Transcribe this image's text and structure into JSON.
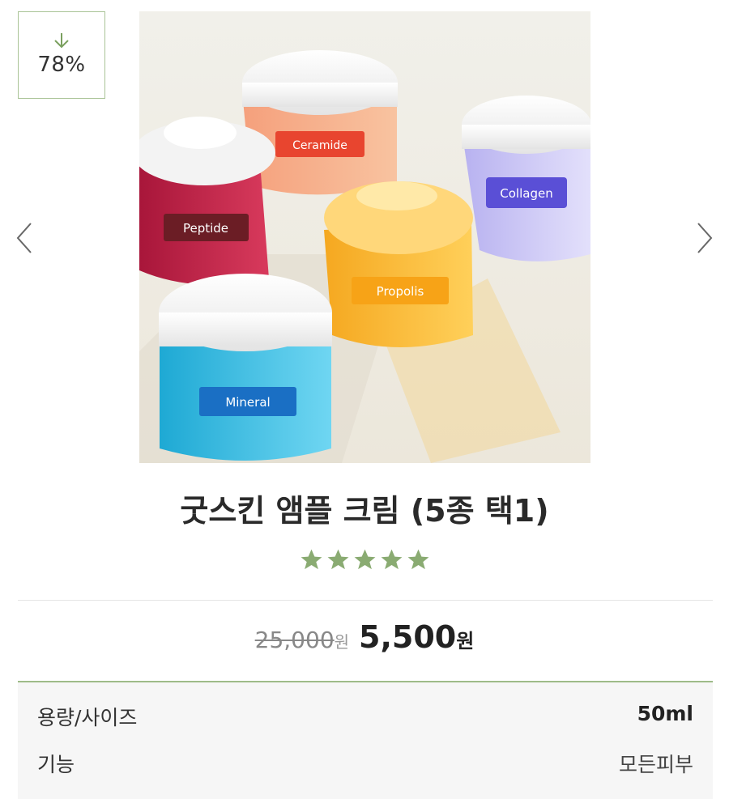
{
  "badge": {
    "discount": "78%",
    "icon": "down-arrow-icon",
    "color": "#a9c396"
  },
  "gallery": {
    "image": "cream-jars-photo",
    "jar_labels": [
      "Peptide",
      "Ceramide",
      "Propolis",
      "Collagen",
      "Mineral"
    ],
    "prev_icon": "chevron-left-icon",
    "next_icon": "chevron-right-icon"
  },
  "product": {
    "title": "굿스킨 앰플 크림 (5종 택1)",
    "rating": 5,
    "star_color": "#8aab72"
  },
  "price": {
    "original": "25,000",
    "original_unit": "원",
    "sale": "5,500",
    "sale_unit": "원"
  },
  "info": {
    "rows": [
      {
        "label": "용량/사이즈",
        "value": "50ml"
      },
      {
        "label": "기능",
        "value": "모든피부"
      }
    ],
    "accent": "#9ebb88"
  }
}
